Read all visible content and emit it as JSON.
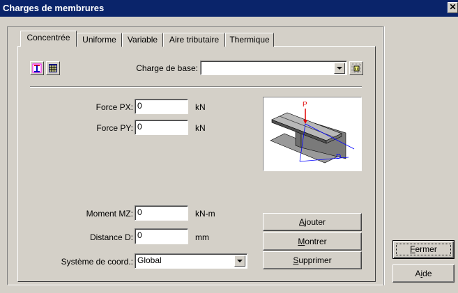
{
  "window": {
    "title": "Charges de membrures",
    "close_glyph": "✕"
  },
  "tabs": [
    {
      "label": "Concentrée",
      "active": true
    },
    {
      "label": "Uniforme",
      "active": false
    },
    {
      "label": "Variable",
      "active": false
    },
    {
      "label": "Aire tributaire",
      "active": false
    },
    {
      "label": "Thermique",
      "active": false
    }
  ],
  "toolbar": {
    "icons": [
      "member-diagram-icon",
      "table-icon"
    ]
  },
  "base_load": {
    "label": "Charge de base:",
    "value": "",
    "side_icon": "pattern-icon"
  },
  "fields": {
    "force_px": {
      "label": "Force PX:",
      "value": "0",
      "unit": "kN"
    },
    "force_py": {
      "label": "Force PY:",
      "value": "0",
      "unit": "kN"
    },
    "moment_mz": {
      "label": "Moment MZ:",
      "value": "0",
      "unit": "kN-m"
    },
    "distance_d": {
      "label": "Distance D:",
      "value": "0",
      "unit": "mm"
    }
  },
  "coord_system": {
    "label": "Système de coord.:",
    "value": "Global"
  },
  "diagram": {
    "p_label": "P",
    "d_label": "D",
    "colors": {
      "load": "#e00000",
      "dim": "#0000ff",
      "beam": "#808080"
    }
  },
  "buttons": {
    "ajouter": {
      "pre": "",
      "ul": "A",
      "post": "jouter"
    },
    "montrer": {
      "pre": "",
      "ul": "M",
      "post": "ontrer"
    },
    "supprimer": {
      "pre": "",
      "ul": "S",
      "post": "upprimer"
    },
    "fermer": {
      "pre": "",
      "ul": "F",
      "post": "ermer"
    },
    "aide": {
      "pre": "A",
      "ul": "i",
      "post": "de"
    }
  }
}
